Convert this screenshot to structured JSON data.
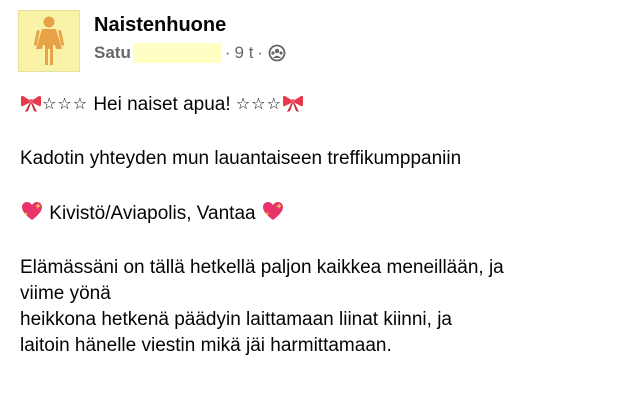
{
  "post": {
    "group_name": "Naistenhuone",
    "author": "Satu",
    "time": "9 t",
    "separator": "·",
    "audience_icon": "globe-group-icon",
    "lines": {
      "l1_stars_left": "☆☆☆",
      "l1_text": "Hei naiset apua!",
      "l1_stars_right": "☆☆☆",
      "l2": "Kadotin yhteyden mun lauantaiseen treffikumppaniin",
      "l3": "Kivistö/Aviapolis, Vantaa",
      "l4a": "Elämässäni on tällä hetkellä paljon kaikkea meneillään, ja",
      "l4b": "viime yönä",
      "l4c": "heikkona hetkenä päädyin laittamaan liinat kiinni, ja",
      "l4d": "laitoin hänelle viestin mikä jäi harmittamaan."
    },
    "icons": {
      "ribbon": "ribbon-emoji",
      "sparkling_heart": "sparkling-heart-emoji",
      "avatar": "woman-restroom-icon"
    },
    "colors": {
      "avatar_bg": "#f9f3a8",
      "avatar_figure": "#e8a349",
      "redaction": "#ffffc4",
      "ribbon": "#e8394a",
      "heart": "#e8336b"
    }
  }
}
